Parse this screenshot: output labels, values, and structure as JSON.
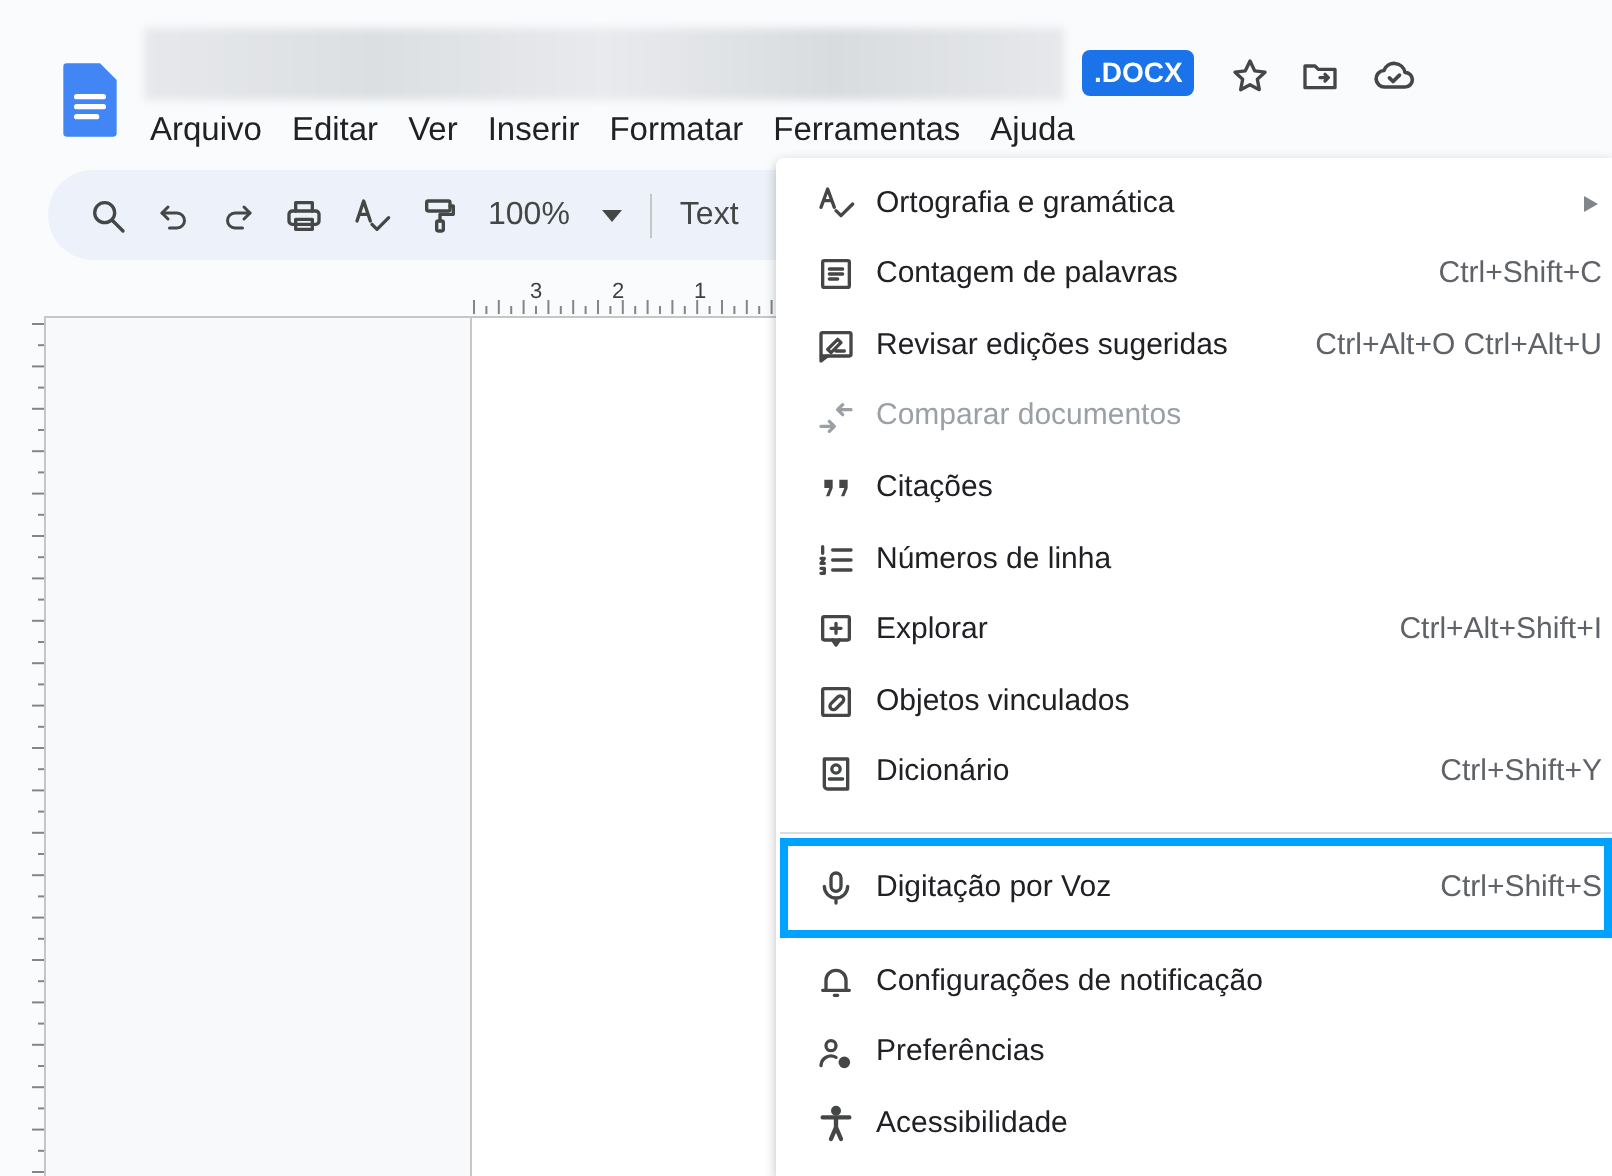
{
  "document": {
    "badge": ".DOCX"
  },
  "menu_bar": [
    {
      "label": "Arquivo",
      "selected": false
    },
    {
      "label": "Editar",
      "selected": false
    },
    {
      "label": "Ver",
      "selected": false
    },
    {
      "label": "Inserir",
      "selected": false
    },
    {
      "label": "Formatar",
      "selected": false
    },
    {
      "label": "Ferramentas",
      "selected": false
    },
    {
      "label": "Ajuda",
      "selected": false
    }
  ],
  "toolbar": {
    "zoom": "100%",
    "style": "Text"
  },
  "ruler": {
    "marks": [
      "3",
      "2",
      "1"
    ]
  },
  "menu": {
    "items": [
      {
        "kind": "item",
        "label": "Ortografia e gramática",
        "submenu": true,
        "disabled": false,
        "selected": false
      },
      {
        "kind": "item",
        "label": "Contagem de palavras",
        "shortcut": "Ctrl+Shift+C",
        "disabled": false,
        "selected": false
      },
      {
        "kind": "item",
        "label": "Revisar edições sugeridas",
        "shortcut": "Ctrl+Alt+O Ctrl+Alt+U",
        "disabled": false,
        "selected": false
      },
      {
        "kind": "item",
        "label": "Comparar documentos",
        "disabled": true,
        "selected": false
      },
      {
        "kind": "item",
        "label": "Citações",
        "disabled": false,
        "selected": false
      },
      {
        "kind": "item",
        "label": "Números de linha",
        "disabled": false,
        "selected": false
      },
      {
        "kind": "item",
        "label": "Explorar",
        "shortcut": "Ctrl+Alt+Shift+I",
        "disabled": false,
        "selected": false
      },
      {
        "kind": "item",
        "label": "Objetos vinculados",
        "disabled": false,
        "selected": false
      },
      {
        "kind": "item",
        "label": "Dicionário",
        "shortcut": "Ctrl+Shift+Y",
        "disabled": false,
        "selected": false
      },
      {
        "kind": "divider"
      },
      {
        "kind": "item",
        "label": "Digitação por Voz",
        "shortcut": "Ctrl+Shift+S",
        "disabled": false,
        "selected": true
      },
      {
        "kind": "item",
        "label": "Configurações de notificação",
        "disabled": false,
        "selected": false
      },
      {
        "kind": "item",
        "label": "Preferências",
        "disabled": false,
        "selected": false
      },
      {
        "kind": "item",
        "label": "Acessibilidade",
        "disabled": false,
        "selected": false
      }
    ]
  }
}
